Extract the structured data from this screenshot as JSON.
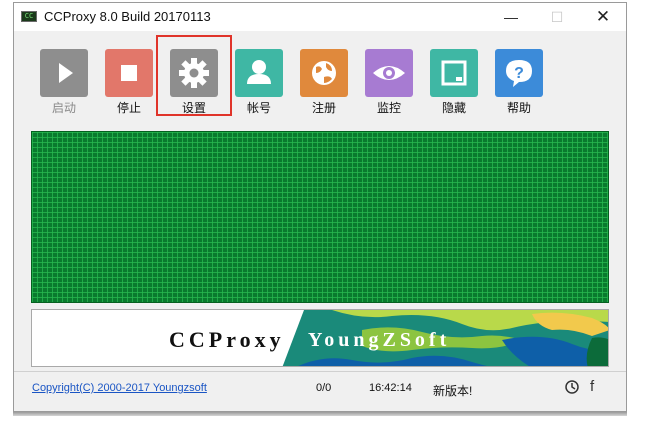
{
  "window": {
    "title": "CCProxy 8.0 Build 20170113",
    "app_icon_text": "CC",
    "minimize_glyph": "—",
    "maximize_glyph": "☐",
    "close_glyph": "✕"
  },
  "toolbar": {
    "buttons": [
      {
        "label": "启动",
        "icon": "play-icon",
        "color": "#8e8e8e",
        "disabled": true
      },
      {
        "label": "停止",
        "icon": "stop-icon",
        "color": "#e2776a"
      },
      {
        "label": "设置",
        "icon": "gear-icon",
        "color": "#8e8e8e",
        "highlighted": true
      },
      {
        "label": "帐号",
        "icon": "user-icon",
        "color": "#3fb7a4"
      },
      {
        "label": "注册",
        "icon": "globe-icon",
        "color": "#e0893c"
      },
      {
        "label": "监控",
        "icon": "eye-icon",
        "color": "#a77bd2"
      },
      {
        "label": "隐藏",
        "icon": "window-icon",
        "color": "#3fb7a4"
      },
      {
        "label": "帮助",
        "icon": "help-icon",
        "color": "#3c8bd9"
      }
    ],
    "highlight_color": "#e0342a"
  },
  "monitor": {
    "grid_color": "#0a7a2e",
    "line_color": "#28b950"
  },
  "banner": {
    "product": "CCProxy",
    "company": "YoungZSoft"
  },
  "status": {
    "copyright": "Copyright(C) 2000-2017 Youngzsoft",
    "connections": "0/0",
    "time": "16:42:14",
    "new_version": "新版本!",
    "facebook_glyph": "f"
  }
}
